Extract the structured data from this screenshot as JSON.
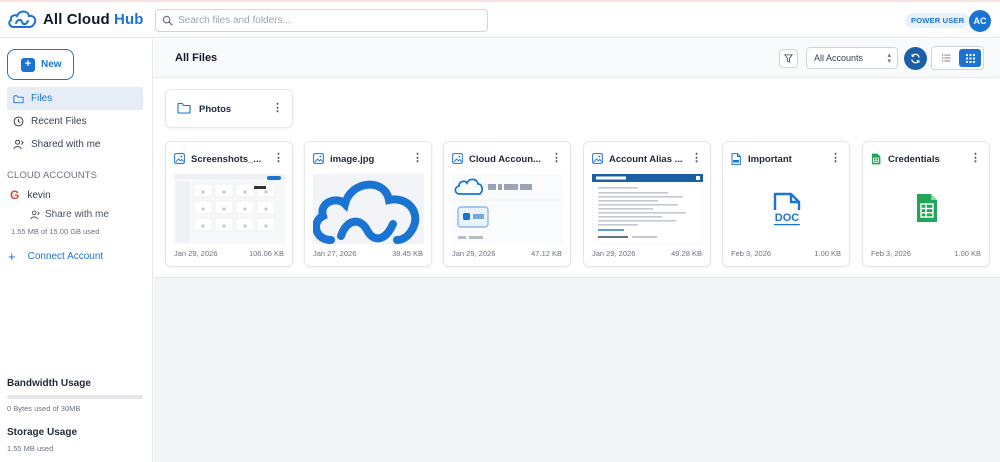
{
  "app": {
    "name_main": "All Cloud",
    "name_accent": "Hub"
  },
  "header": {
    "search_placeholder": "Search files and folders...",
    "badge": "POWER USER",
    "avatar_initials": "AC"
  },
  "colors": {
    "accent": "#1b74d1",
    "refresh": "#1b5fa8",
    "doc_icon": "#1b74d1",
    "sheet_icon": "#22a559",
    "google_red": "#ea4335"
  },
  "sidebar": {
    "new_label": "New",
    "items": [
      {
        "label": "Files",
        "icon": "folder-icon",
        "active": true
      },
      {
        "label": "Recent Files",
        "icon": "clock-icon",
        "active": false
      },
      {
        "label": "Shared with me",
        "icon": "user-share-icon",
        "active": false
      }
    ],
    "accounts_section": "CLOUD ACCOUNTS",
    "account": {
      "icon": "google-icon",
      "name": "kevin",
      "share_label": "Share with me",
      "used": "1.55 MB of 15.00 GB used"
    },
    "connect_label": "Connect Account",
    "bandwidth": {
      "title": "Bandwidth Usage",
      "sub": "0 Bytes used of 30MB",
      "fraction": 0
    },
    "storage": {
      "title": "Storage Usage",
      "sub": "1.55 MB used"
    }
  },
  "main": {
    "title": "All Files",
    "account_filter": "All Accounts",
    "folders": [
      {
        "name": "Photos",
        "icon": "folder-icon"
      }
    ],
    "files": [
      {
        "name": "Screenshots_...",
        "icon": "image-icon",
        "thumb": "screenshot",
        "date": "Jan 29, 2026",
        "size": "106.06 KB"
      },
      {
        "name": "image.jpg",
        "icon": "image-icon",
        "thumb": "cloud-logo",
        "date": "Jan 27, 2026",
        "size": "38.45 KB"
      },
      {
        "name": "Cloud Accoun...",
        "icon": "image-icon",
        "thumb": "app-ui",
        "date": "Jan 29, 2026",
        "size": "47.12 KB"
      },
      {
        "name": "Account Alias ...",
        "icon": "image-icon",
        "thumb": "dialog",
        "date": "Jan 29, 2026",
        "size": "49.28 KB"
      },
      {
        "name": "Important",
        "icon": "doc-icon",
        "thumb": "doc",
        "date": "Feb 3, 2026",
        "size": "1.00 KB"
      },
      {
        "name": "Credentials",
        "icon": "sheet-icon",
        "thumb": "sheet",
        "date": "Feb 3, 2026",
        "size": "1.00 KB"
      }
    ]
  }
}
